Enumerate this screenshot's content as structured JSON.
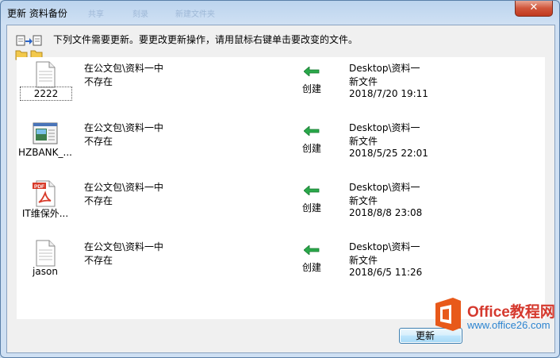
{
  "window": {
    "title": "更新 资料备份",
    "close_glyph": "✕",
    "ghost_menu": [
      "共享",
      "刻录",
      "新建文件夹"
    ]
  },
  "instruction": "下列文件需要更新。要更改更新操作，请用鼠标右键单击要改变的文件。",
  "rows": [
    {
      "name": "2222",
      "icon": "text-file-icon",
      "selected": true,
      "src_path": "在公文包\\资料一中",
      "src_status": "不存在",
      "action": "创建",
      "dst_path": "Desktop\\资料一",
      "dst_type": "新文件",
      "dst_time": "2018/7/20 19:11"
    },
    {
      "name": "HZBANK_...",
      "icon": "application-window-icon",
      "selected": false,
      "src_path": "在公文包\\资料一中",
      "src_status": "不存在",
      "action": "创建",
      "dst_path": "Desktop\\资料一",
      "dst_type": "新文件",
      "dst_time": "2018/5/25 22:01"
    },
    {
      "name": "IT维保外...",
      "icon": "pdf-file-icon",
      "selected": false,
      "src_path": "在公文包\\资料一中",
      "src_status": "不存在",
      "action": "创建",
      "dst_path": "Desktop\\资料一",
      "dst_type": "新文件",
      "dst_time": "2018/8/8 23:08"
    },
    {
      "name": "jason",
      "icon": "text-file-icon",
      "selected": false,
      "src_path": "在公文包\\资料一中",
      "src_status": "不存在",
      "action": "创建",
      "dst_path": "Desktop\\资料一",
      "dst_type": "新文件",
      "dst_time": "2018/6/5 11:26"
    }
  ],
  "buttons": {
    "update_label": "更新"
  },
  "watermark": {
    "brand": "Office教程网",
    "url": "www.office26.com"
  },
  "colors": {
    "arrow_green": "#2aa84a",
    "pdf_red": "#d83b2a",
    "watermark_orange": "#e8591a"
  }
}
